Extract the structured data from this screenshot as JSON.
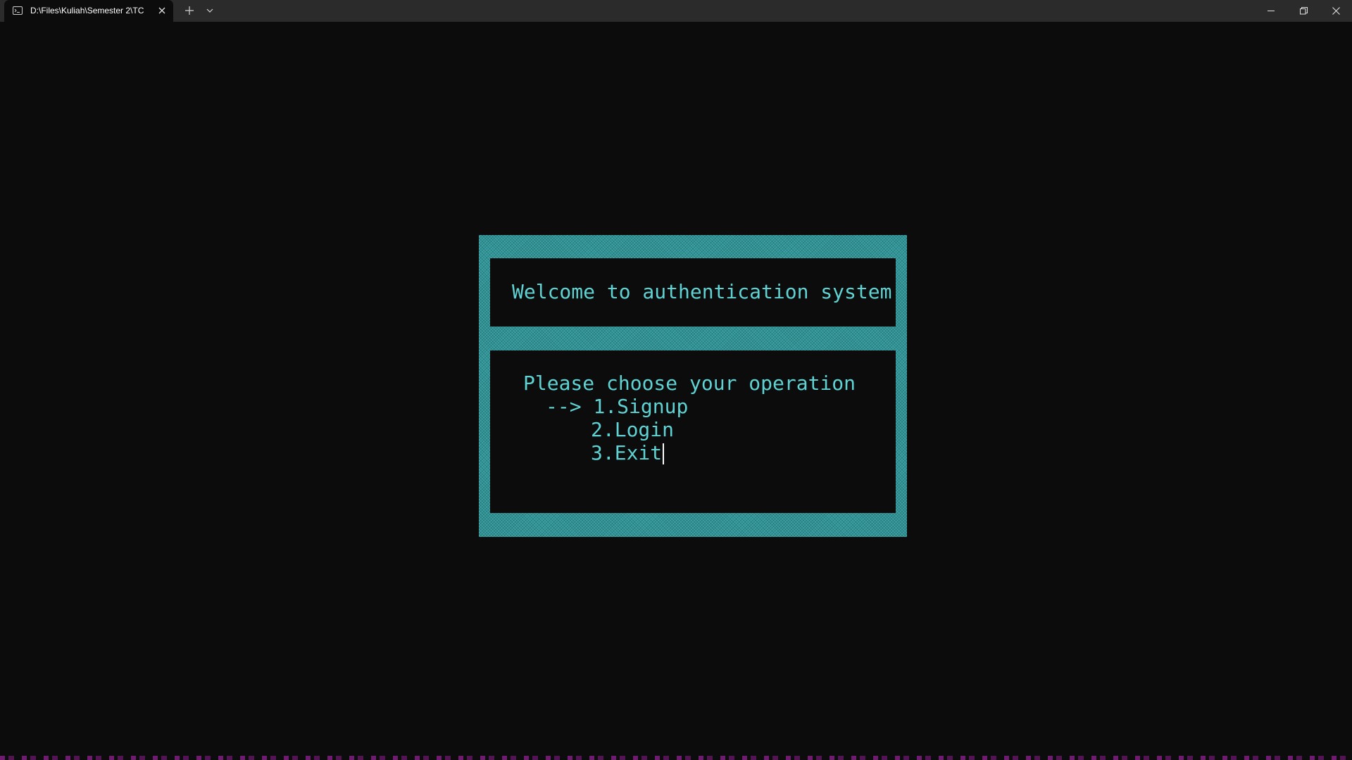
{
  "window": {
    "tab_title": "D:\\Files\\Kuliah\\Semester 2\\TC",
    "icons": {
      "tab": "terminal-icon",
      "close_tab": "close-icon",
      "new_tab": "plus-icon",
      "dropdown": "chevron-down-icon",
      "minimize": "minimize-icon",
      "maximize": "restore-icon",
      "close": "close-icon"
    }
  },
  "terminal": {
    "colors": {
      "background": "#0c0c0c",
      "frame": "#3aa3a6",
      "text": "#5fd3d3"
    },
    "header": {
      "title": "Welcome to authentication system"
    },
    "menu": {
      "prompt": "Please choose your operation",
      "selector": "-->",
      "selected_index": 0,
      "options": [
        "1.Signup",
        "2.Login",
        "3.Exit"
      ]
    }
  }
}
